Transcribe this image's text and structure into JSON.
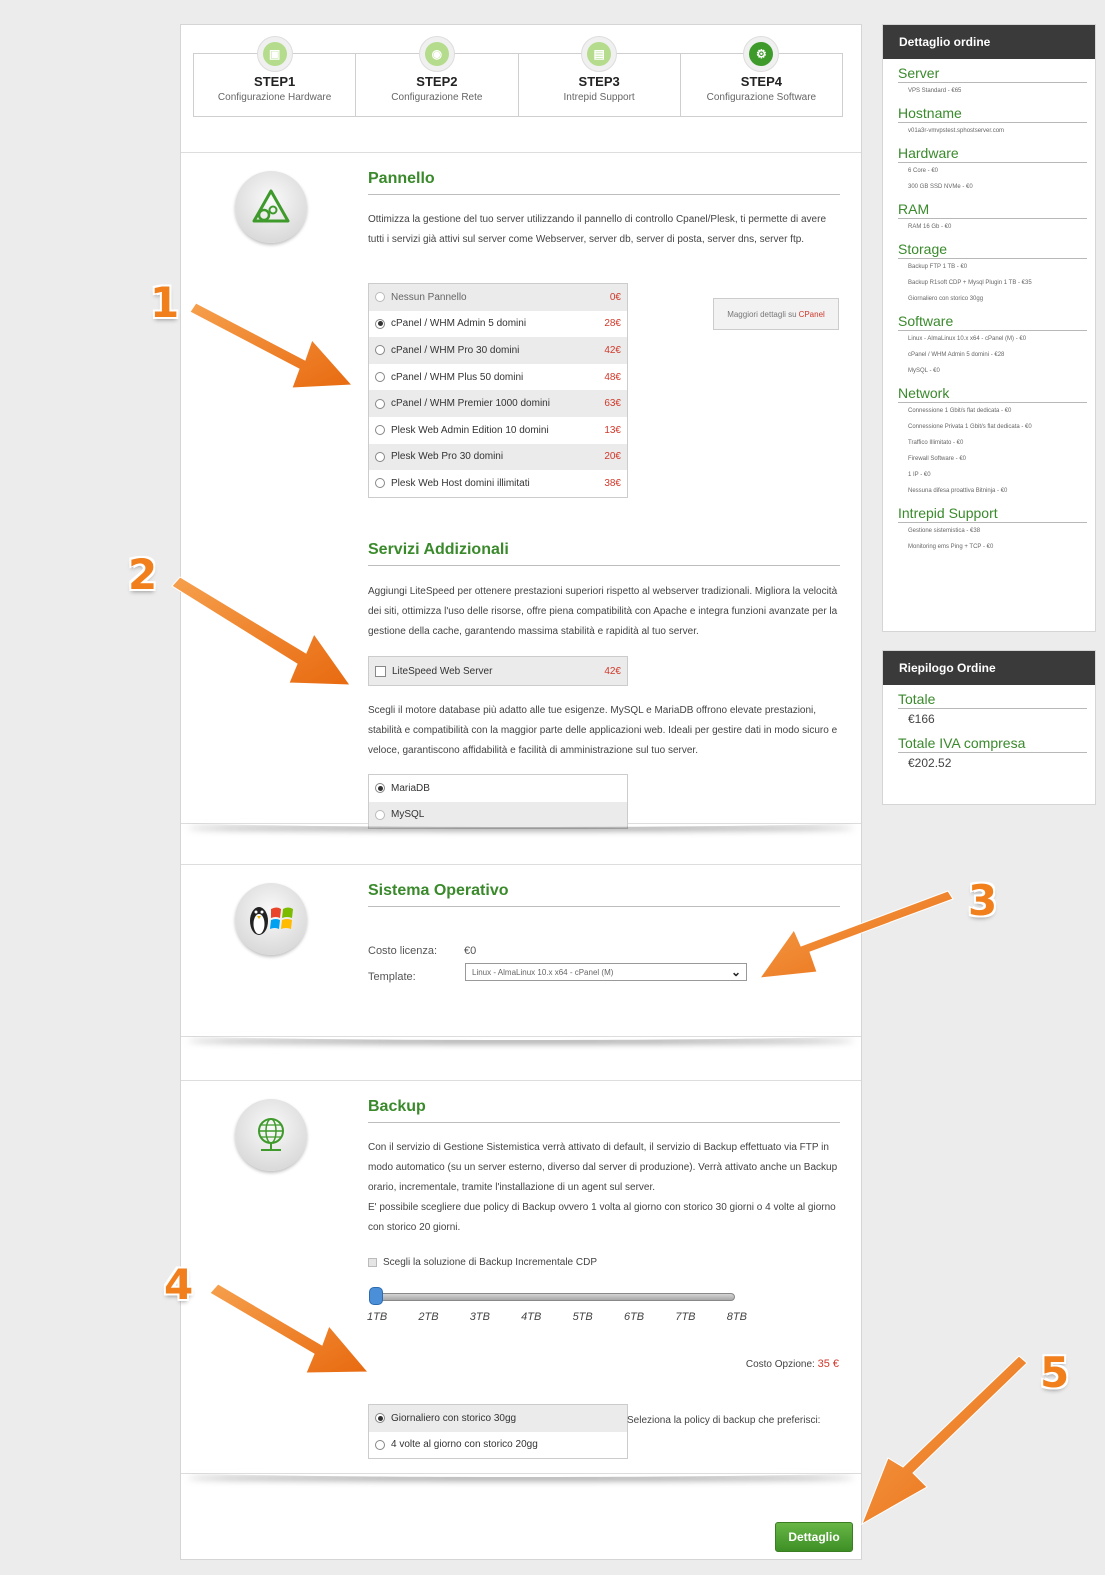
{
  "steps": [
    {
      "title": "STEP1",
      "subtitle": "Configurazione Hardware"
    },
    {
      "title": "STEP2",
      "subtitle": "Configurazione Rete"
    },
    {
      "title": "STEP3",
      "subtitle": "Intrepid Support"
    },
    {
      "title": "STEP4",
      "subtitle": "Configurazione Software"
    }
  ],
  "pannello": {
    "title": "Pannello",
    "description": "Ottimizza la gestione del tuo server utilizzando il pannello di controllo Cpanel/Plesk, ti permette di avere tutti i servizi già attivi sul server come Webserver, server db, server di posta, server dns, server ftp.",
    "options": [
      {
        "label": "Nessun Pannello",
        "price": "0€",
        "selected": false
      },
      {
        "label": "cPanel / WHM Admin 5 domini",
        "price": "28€",
        "selected": true
      },
      {
        "label": "cPanel / WHM Pro 30 domini",
        "price": "42€",
        "selected": false
      },
      {
        "label": "cPanel / WHM Plus 50 domini",
        "price": "48€",
        "selected": false
      },
      {
        "label": "cPanel / WHM Premier 1000 domini",
        "price": "63€",
        "selected": false
      },
      {
        "label": "Plesk Web Admin Edition 10 domini",
        "price": "13€",
        "selected": false
      },
      {
        "label": "Plesk Web Pro 30 domini",
        "price": "20€",
        "selected": false
      },
      {
        "label": "Plesk Web Host domini illimitati",
        "price": "38€",
        "selected": false
      }
    ],
    "more_button": {
      "label": "Maggiori dettagli su",
      "brand": "CPanel"
    }
  },
  "servizi": {
    "title": "Servizi Addizionali",
    "description": "Aggiungi LiteSpeed per ottenere prestazioni superiori rispetto al webserver tradizionali. Migliora la velocità dei siti, ottimizza l'uso delle risorse, offre piena compatibilità con Apache e integra funzioni avanzate per la gestione della cache, garantendo massima stabilità e rapidità al tuo server.",
    "litespeed": {
      "label": "LiteSpeed Web Server",
      "price": "42€"
    },
    "db_description": "Scegli il motore database più adatto alle tue esigenze. MySQL e MariaDB offrono elevate prestazioni, stabilità e compatibilità con la maggior parte delle applicazioni web. Ideali per gestire dati in modo sicuro e veloce, garantiscono affidabilità e facilità di amministrazione sul tuo server.",
    "db_options": [
      {
        "label": "MariaDB",
        "selected": true
      },
      {
        "label": "MySQL",
        "selected": false
      }
    ]
  },
  "os": {
    "title": "Sistema Operativo",
    "license_label": "Costo licenza:",
    "license_value": "€0",
    "template_label": "Template:",
    "template_value": "Linux - AlmaLinux 10.x x64 - cPanel (M)"
  },
  "backup": {
    "title": "Backup",
    "description_1": "Con il servizio di Gestione Sistemistica verrà attivato di default, il servizio di Backup effettuato via FTP in modo automatico (su un server esterno, diverso dal server di produzione). Verrà attivato anche un Backup orario, incrementale, tramite l'installazione di un agent sul server.",
    "description_2": "E' possibile scegliere due policy di Backup ovvero 1 volta al giorno con storico 30 giorni o 4 volte al giorno con storico 20 giorni.",
    "cdp_label": "Scegli la soluzione di Backup Incrementale CDP",
    "slider_ticks": [
      "1TB",
      "2TB",
      "3TB",
      "4TB",
      "5TB",
      "6TB",
      "7TB",
      "8TB"
    ],
    "slider_value_index": 0,
    "cost_label": "Costo Opzione:",
    "cost_value": "35 €",
    "policy_options": [
      {
        "label": "Giornaliero con storico 30gg",
        "selected": true
      },
      {
        "label": "4 volte al giorno con storico 20gg",
        "selected": false
      }
    ],
    "policy_note": "Seleziona la policy di backup che preferisci:"
  },
  "dettaglio_button": "Dettaglio",
  "sidebar": {
    "order_title": "Dettaglio ordine",
    "sections": [
      {
        "title": "Server",
        "items": [
          "VPS Standard - €65"
        ]
      },
      {
        "title": "Hostname",
        "items": [
          "v01a3r-vmvpstest.sphostserver.com"
        ]
      },
      {
        "title": "Hardware",
        "items": [
          "6 Core - €0",
          "300 GB SSD NVMe - €0"
        ]
      },
      {
        "title": "RAM",
        "items": [
          "RAM 16 Gb - €0"
        ]
      },
      {
        "title": "Storage",
        "items": [
          "Backup FTP 1 TB - €0",
          "Backup R1soft CDP + Mysql Plugin 1 TB - €35",
          "Giornaliero con storico 30gg"
        ]
      },
      {
        "title": "Software",
        "items": [
          "Linux - AlmaLinux 10.x x64 - cPanel (M) - €0",
          "cPanel / WHM Admin 5 domini - €28",
          "MySQL - €0"
        ]
      },
      {
        "title": "Network",
        "items": [
          "Connessione 1 Gbit/s flat dedicata - €0",
          "Connessione Privata 1 Gbit/s flat dedicata - €0",
          "Traffico Illimitato - €0",
          "Firewall Software - €0",
          "1 IP - €0",
          "Nessuna difesa proattiva Bitninja - €0"
        ]
      },
      {
        "title": "Intrepid Support",
        "items": [
          "Gestione sistemistica - €38",
          "Monitoring ems Ping + TCP - €0"
        ]
      }
    ],
    "summary_title": "Riepilogo Ordine",
    "summary": [
      {
        "title": "Totale",
        "value": "€166"
      },
      {
        "title": "Totale IVA compresa",
        "value": "€202.52"
      }
    ]
  },
  "annotations": [
    "1",
    "2",
    "3",
    "4",
    "5"
  ],
  "colors": {
    "accent_green": "#3a8a2c",
    "price_red": "#d0392b",
    "annotation_orange": "#f07f1c",
    "sidebar_header": "#3a3a3a"
  }
}
